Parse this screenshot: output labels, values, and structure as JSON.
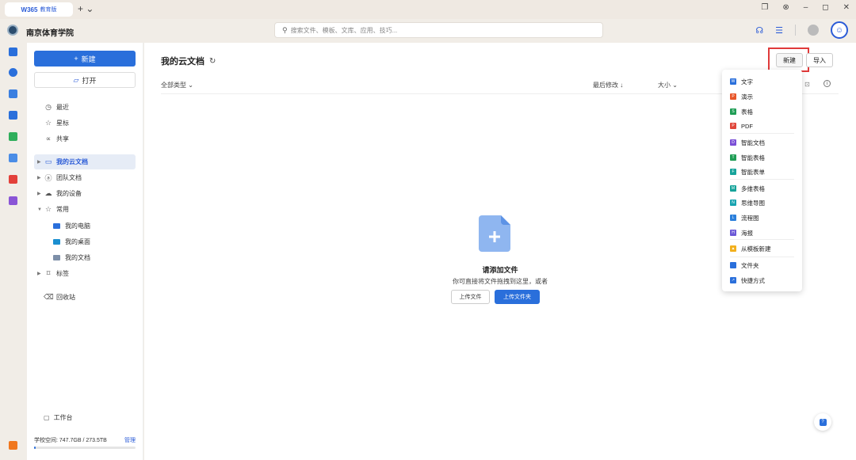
{
  "titlebar": {
    "brand": "W365",
    "edition": "教育版",
    "add_tab": "+ ⌄"
  },
  "header": {
    "org_name": "南京体育学院",
    "search_placeholder": "搜索文件、模板、文库、应用、技巧..."
  },
  "sidebar": {
    "new_label": "新建",
    "open_label": "打开",
    "items": [
      {
        "label": "最近"
      },
      {
        "label": "星标"
      },
      {
        "label": "共享"
      },
      {
        "label": "我的云文档"
      },
      {
        "label": "团队文档"
      },
      {
        "label": "我的设备"
      },
      {
        "label": "常用"
      },
      {
        "label": "我的电脑"
      },
      {
        "label": "我的桌面"
      },
      {
        "label": "我的文档"
      },
      {
        "label": "标签"
      },
      {
        "label": "回收站"
      }
    ],
    "workbench": "工作台",
    "storage_text": "学校空间: 747.7GB / 273.5TB",
    "manage": "管理",
    "storage_fraction": 0.003
  },
  "main": {
    "title": "我的云文档",
    "new_button": "新建",
    "import_button": "导入",
    "columns": {
      "type": "全部类型",
      "modified": "最后修改",
      "size": "大小"
    },
    "empty": {
      "title": "请添加文件",
      "desc": "你可直接将文件拖拽到这里，或者",
      "upload_file": "上传文件",
      "upload_folder": "上传文件夹"
    }
  },
  "dropdown": {
    "items": [
      {
        "label": "文字",
        "color": "#2a6fdb",
        "icon": "W"
      },
      {
        "label": "演示",
        "color": "#e8562a",
        "icon": "P"
      },
      {
        "label": "表格",
        "color": "#1f9d55",
        "icon": "S"
      },
      {
        "label": "PDF",
        "color": "#e0463a",
        "icon": "P"
      },
      {
        "label": "智能文档",
        "color": "#7a4fd6",
        "icon": "D"
      },
      {
        "label": "智能表格",
        "color": "#1f9d55",
        "icon": "T"
      },
      {
        "label": "智能表单",
        "color": "#16a39a",
        "icon": "F"
      },
      {
        "label": "多维表格",
        "color": "#16a39a",
        "icon": "M"
      },
      {
        "label": "思维导图",
        "color": "#16a3b0",
        "icon": "N"
      },
      {
        "label": "流程图",
        "color": "#2a7fdb",
        "icon": "L"
      },
      {
        "label": "海报",
        "color": "#6b58d6",
        "icon": "H"
      },
      {
        "label": "从模板新建",
        "color": "#f2b01e",
        "icon": "▲"
      },
      {
        "label": "文件夹",
        "color": "#2a6fdb",
        "icon": ""
      },
      {
        "label": "快捷方式",
        "color": "#2a6fdb",
        "icon": "↗"
      }
    ]
  }
}
